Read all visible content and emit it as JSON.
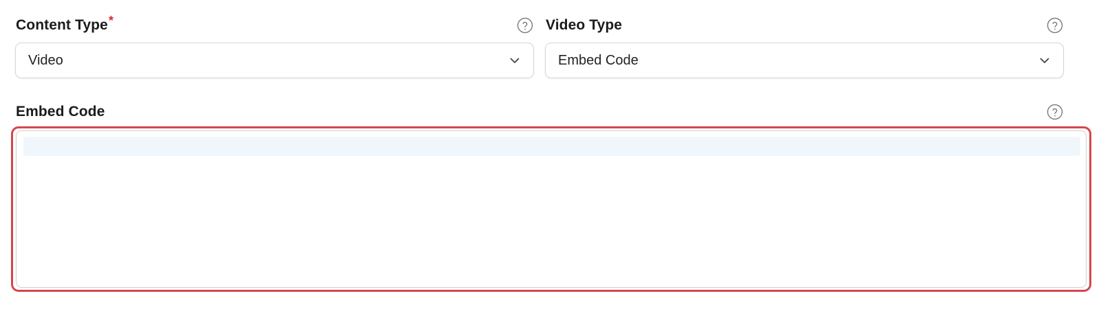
{
  "content_type": {
    "label": "Content Type",
    "required_mark": "*",
    "value": "Video",
    "help_icon": "question-circle-icon",
    "chevron_icon": "chevron-down-icon"
  },
  "video_type": {
    "label": "Video Type",
    "value": "Embed Code",
    "help_icon": "question-circle-icon",
    "chevron_icon": "chevron-down-icon"
  },
  "embed_code": {
    "label": "Embed Code",
    "value": "",
    "help_icon": "question-circle-icon",
    "state": "error"
  },
  "colors": {
    "error_border": "#d6454c",
    "active_line": "#f0f7fc",
    "required_mark": "#d32f2f"
  }
}
